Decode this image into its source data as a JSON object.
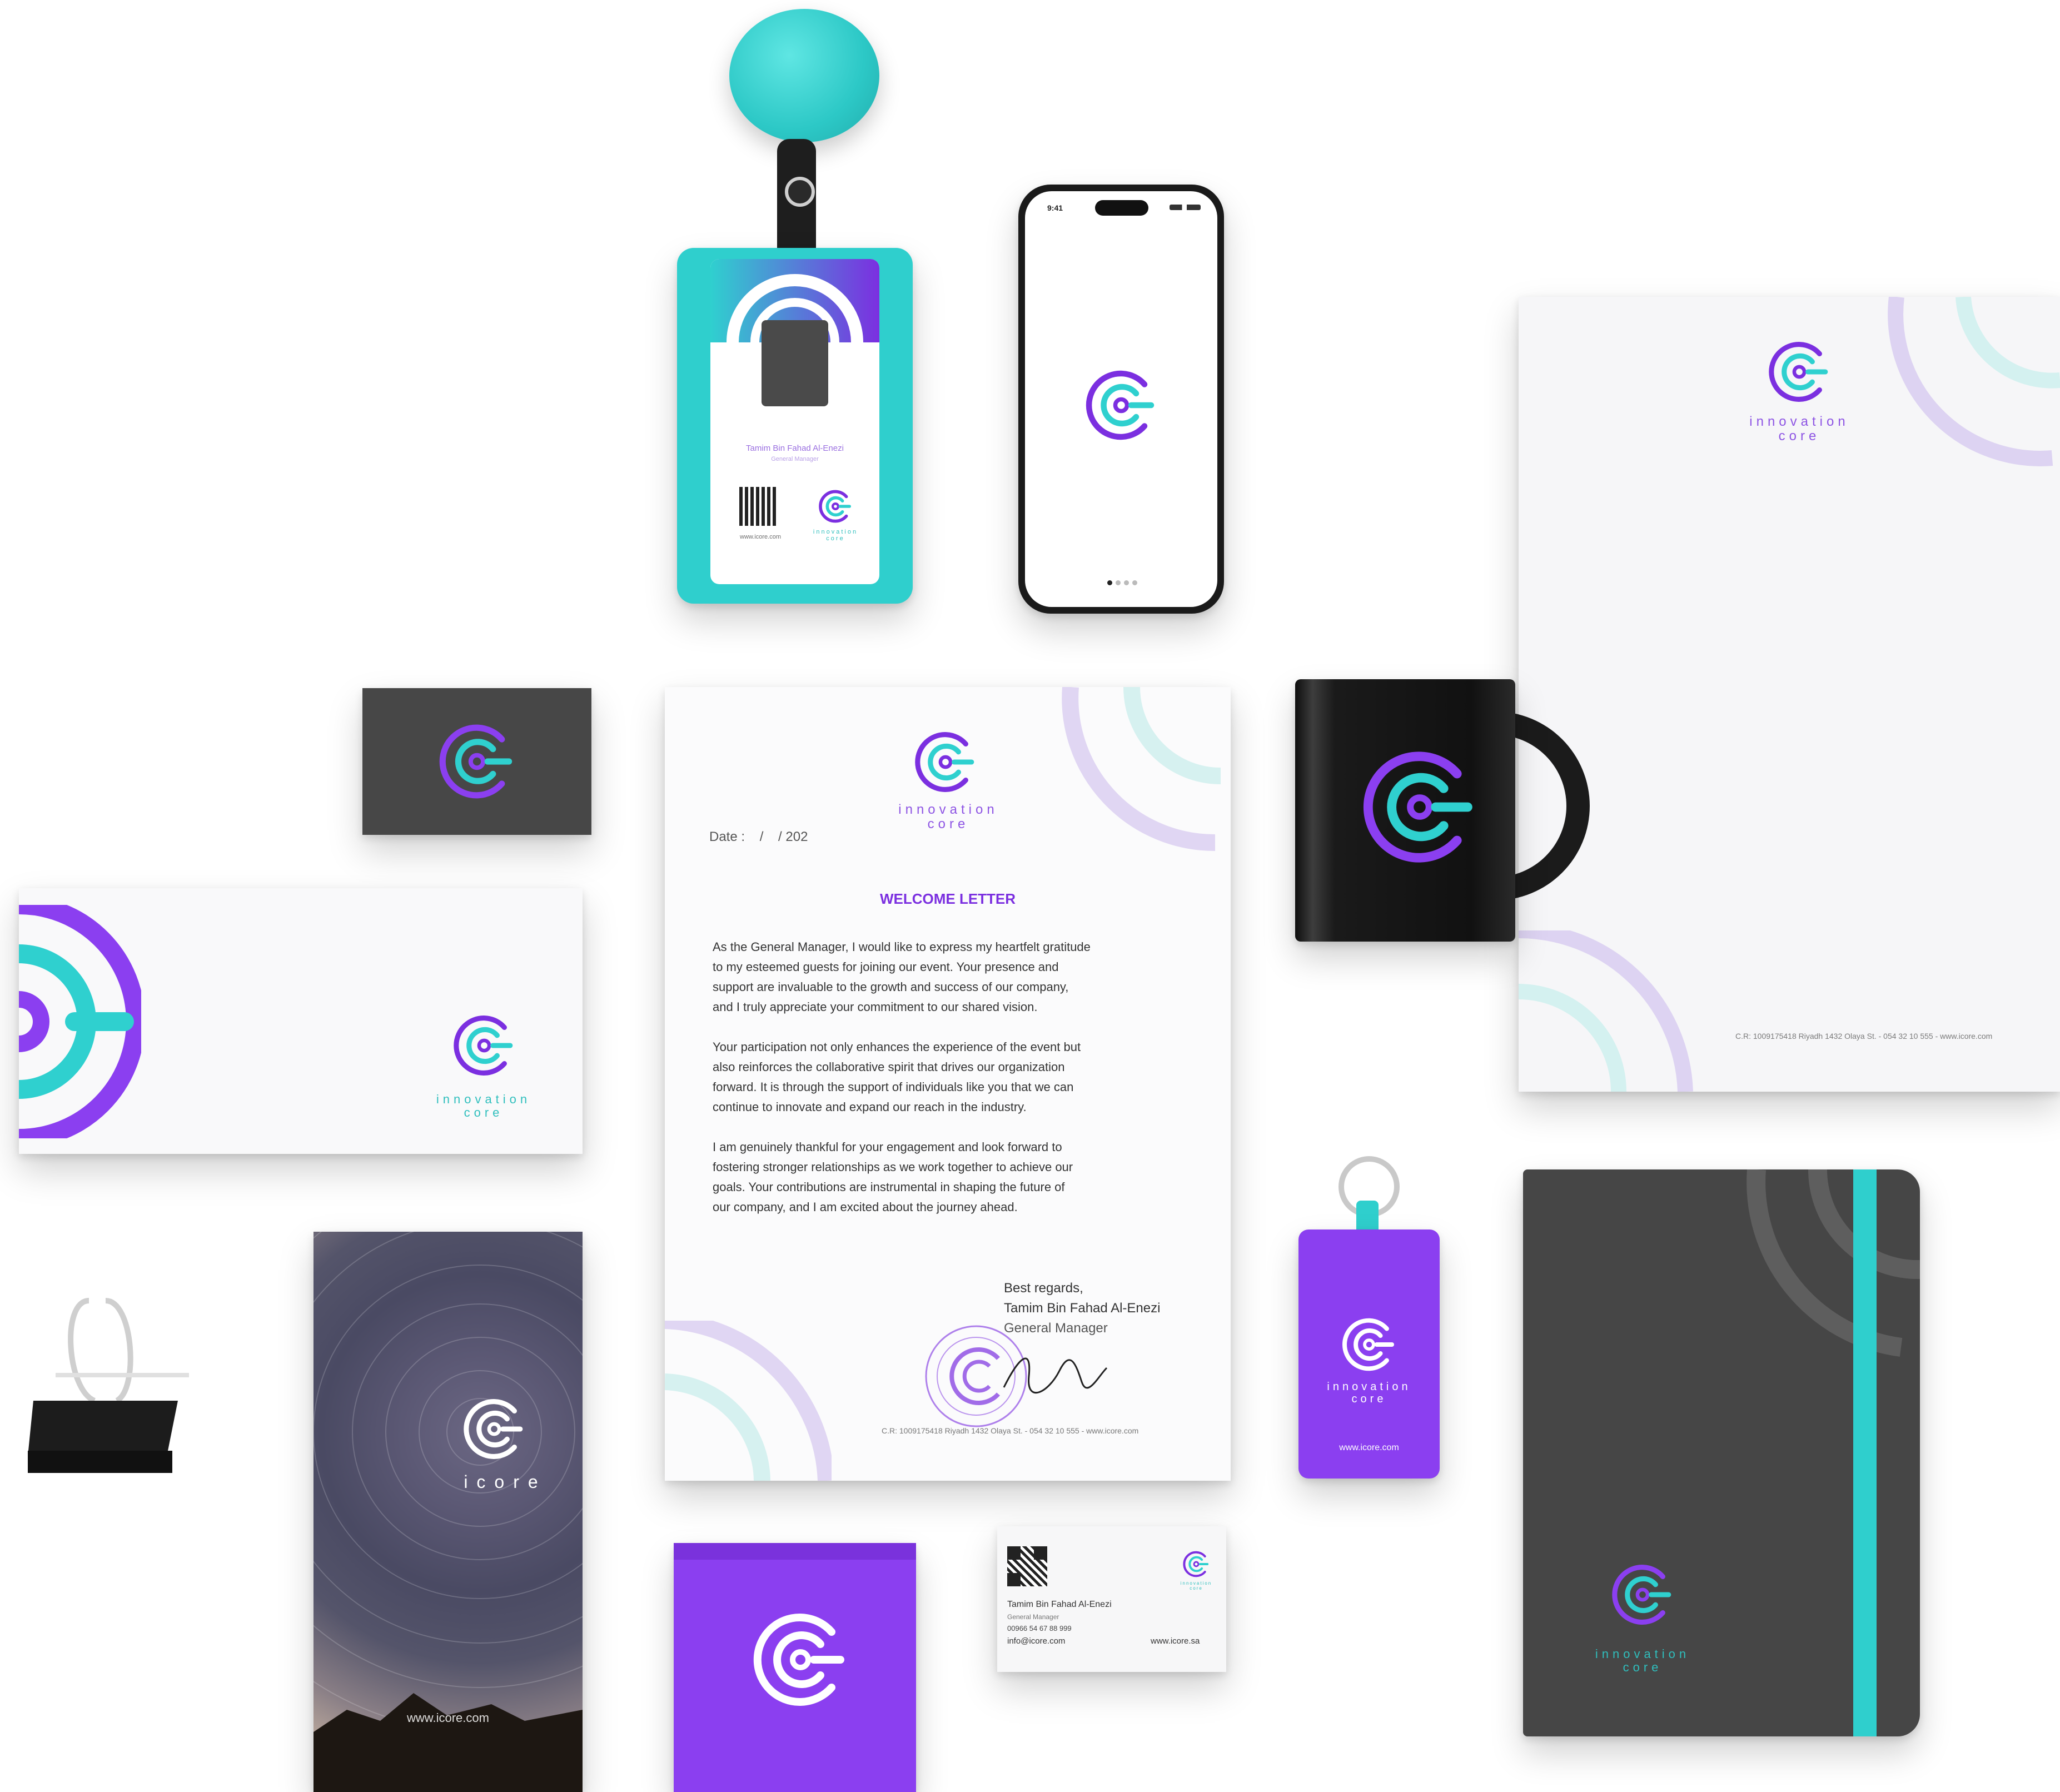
{
  "brand": {
    "wordmark_line1": "innovation",
    "wordmark_line2": "core",
    "short_wordmark": "icore",
    "colors": {
      "purple": "#7b2fe0",
      "teal": "#2fd0cf",
      "dark": "#454545",
      "paper": "#f7f7f8"
    }
  },
  "id_badge": {
    "name": "Tamim Bin Fahad Al-Enezi",
    "title": "General Manager",
    "website": "www.icore.com"
  },
  "phone": {
    "time": "9:41"
  },
  "letterhead": {
    "footer": "C.R: 1009175418 Riyadh 1432 Olaya St. - 054 32 10 555 - www.icore.com"
  },
  "letter": {
    "date": "Date :    /    / 202",
    "heading": "WELCOME LETTER",
    "paragraph1": "As the General Manager, I would like to express my heartfelt gratitude\nto my esteemed guests for joining our event. Your presence and\nsupport are invaluable to the growth and success of our company,\nand I truly appreciate your commitment to our shared vision.",
    "paragraph2": "Your participation not only enhances the experience of the event but\nalso reinforces the collaborative spirit that drives our organization\nforward. It is through the support of individuals like you that we can\ncontinue to innovate and expand our reach in the industry.",
    "paragraph3": "I am genuinely thankful for your engagement and look forward to\nfostering stronger relationships as we work together to achieve our\ngoals. Your contributions are instrumental in shaping the future of\nour company, and I am excited about the journey ahead.",
    "closing": "Best regards,",
    "signer_name": "Tamim Bin Fahad Al-Enezi",
    "signer_title": "General Manager",
    "footer": "C.R: 1009175418 Riyadh 1432 Olaya St. - 054 32 10 555 - www.icore.com"
  },
  "keychain": {
    "website": "www.icore.com"
  },
  "brochure": {
    "website": "www.icore.com"
  },
  "business_card": {
    "name": "Tamim Bin Fahad Al-Enezi",
    "title": "General Manager",
    "phone": "00966 54 67 88 999",
    "email": "info@icore.com",
    "website": "www.icore.sa"
  }
}
